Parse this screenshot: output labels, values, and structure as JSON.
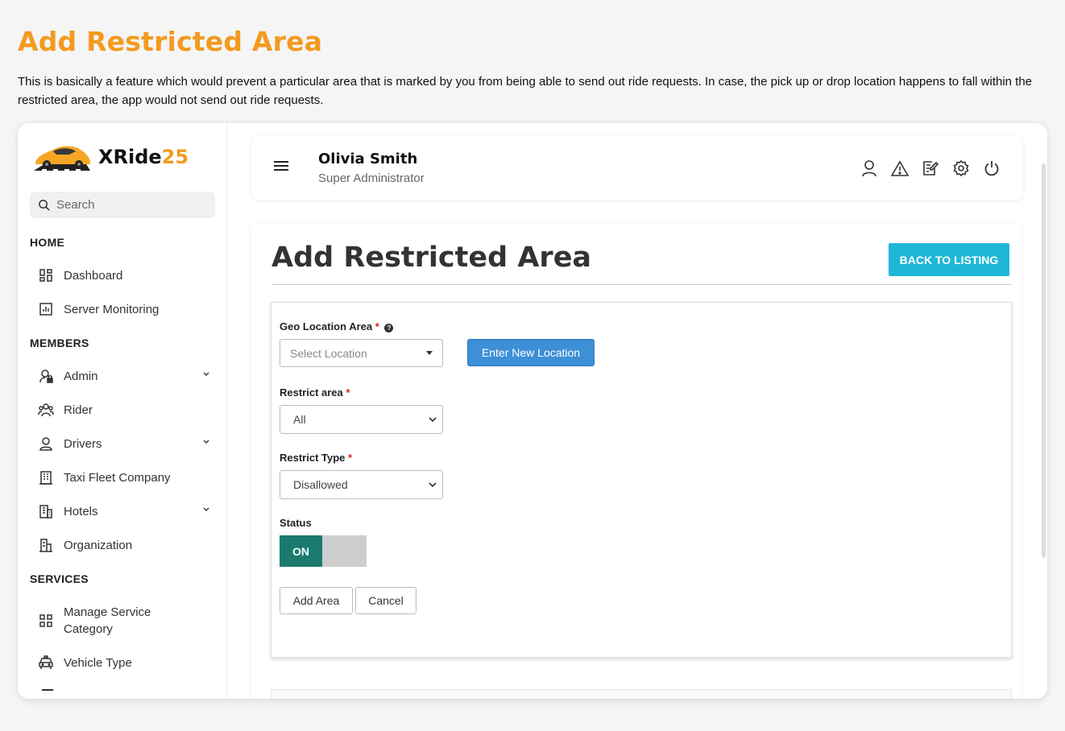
{
  "page": {
    "heading": "Add Restricted Area",
    "description": "This is basically a feature which would prevent a particular area that is marked by you from being able to send out ride requests. In case, the pick up or drop location happens to fall within the restricted area, the app would not send out ride requests."
  },
  "brand": {
    "name_main": "XRide",
    "name_accent": "25",
    "accent_color": "#f39a1f"
  },
  "sidebar": {
    "search_placeholder": "Search",
    "sections": {
      "home": "HOME",
      "members": "MEMBERS",
      "services": "SERVICES"
    },
    "items": [
      {
        "label": "Dashboard",
        "icon": "dashboard-icon"
      },
      {
        "label": "Server Monitoring",
        "icon": "chart-icon"
      },
      {
        "label": "Admin",
        "icon": "admin-user-icon"
      },
      {
        "label": "Rider",
        "icon": "group-icon"
      },
      {
        "label": "Drivers",
        "icon": "driver-icon"
      },
      {
        "label": "Taxi Fleet Company",
        "icon": "building-icon"
      },
      {
        "label": "Hotels",
        "icon": "hotel-icon"
      },
      {
        "label": "Organization",
        "icon": "organization-icon"
      },
      {
        "label": "Manage Service Category",
        "icon": "grid-icon"
      },
      {
        "label": "Vehicle Type",
        "icon": "taxi-icon"
      }
    ]
  },
  "header": {
    "user_name": "Olivia Smith",
    "user_role": "Super Administrator"
  },
  "main": {
    "title": "Add Restricted Area",
    "back_button": "BACK TO LISTING",
    "form": {
      "geo_label": "Geo Location Area",
      "geo_placeholder": "Select Location",
      "new_location_button": "Enter New Location",
      "restrict_area_label": "Restrict area",
      "restrict_area_value": "All",
      "restrict_type_label": "Restrict Type",
      "restrict_type_value": "Disallowed",
      "status_label": "Status",
      "status_value": "ON",
      "add_button": "Add Area",
      "cancel_button": "Cancel",
      "required_mark": "*"
    }
  },
  "colors": {
    "accent_orange": "#f39a1f",
    "back_button": "#1fb7d8",
    "primary_button": "#3d8fd6",
    "toggle_on": "#1a7a6e"
  }
}
